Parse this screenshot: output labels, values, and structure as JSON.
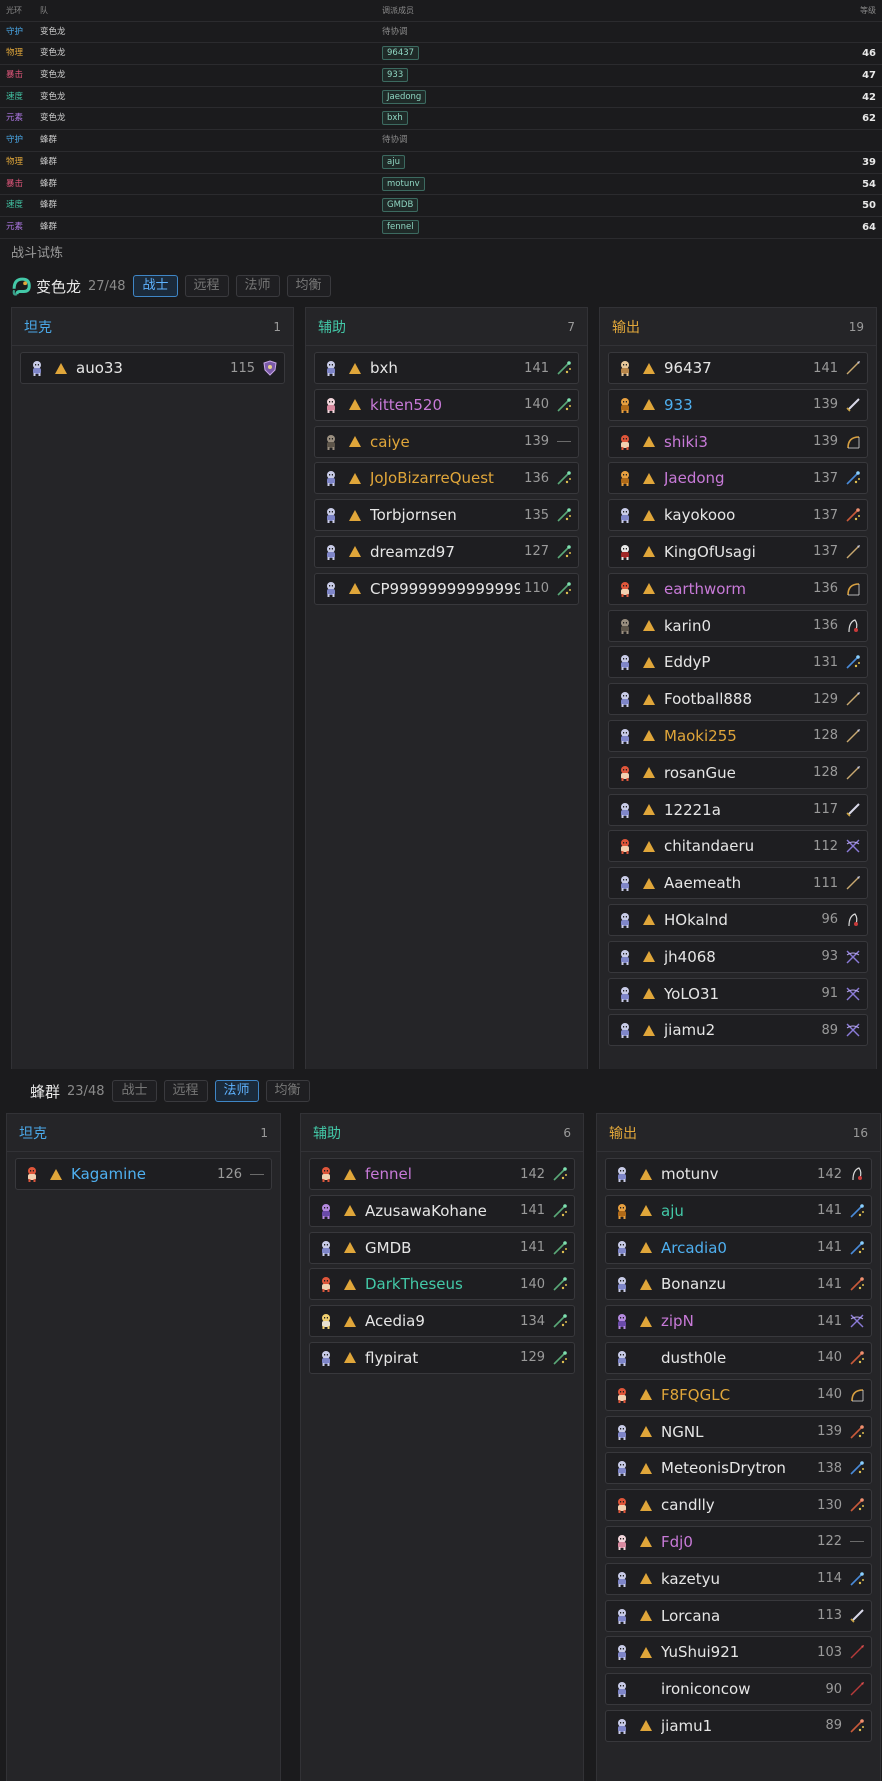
{
  "colors": {
    "tank": "#4aa8e8",
    "support": "#43c9a8",
    "dps": "#e0a63a",
    "blue": "#4fb0f0",
    "pink": "#c87ad8",
    "orange": "#e0a63a",
    "teal": "#43c9a8",
    "white": "#e6e6e6"
  },
  "table": {
    "headers": [
      "光环",
      "队",
      "调派成员",
      "等级"
    ],
    "rows": [
      {
        "aura": "守护",
        "aura_color": "#4aa8e8",
        "team": "变色龙",
        "member": "待协调",
        "pending": true,
        "level": ""
      },
      {
        "aura": "物理",
        "aura_color": "#e0a63a",
        "team": "变色龙",
        "member": "96437",
        "pending": false,
        "level": "46"
      },
      {
        "aura": "暴击",
        "aura_color": "#e0567a",
        "team": "变色龙",
        "member": "933",
        "pending": false,
        "level": "47"
      },
      {
        "aura": "速度",
        "aura_color": "#43c9a8",
        "team": "变色龙",
        "member": "Jaedong",
        "pending": false,
        "level": "42"
      },
      {
        "aura": "元素",
        "aura_color": "#b07ae8",
        "team": "变色龙",
        "member": "bxh",
        "pending": false,
        "level": "62"
      },
      {
        "aura": "守护",
        "aura_color": "#4aa8e8",
        "team": "蜂群",
        "member": "待协调",
        "pending": true,
        "level": ""
      },
      {
        "aura": "物理",
        "aura_color": "#e0a63a",
        "team": "蜂群",
        "member": "aju",
        "pending": false,
        "level": "39"
      },
      {
        "aura": "暴击",
        "aura_color": "#e0567a",
        "team": "蜂群",
        "member": "motunv",
        "pending": false,
        "level": "54"
      },
      {
        "aura": "速度",
        "aura_color": "#43c9a8",
        "team": "蜂群",
        "member": "GMDB",
        "pending": false,
        "level": "50"
      },
      {
        "aura": "元素",
        "aura_color": "#b07ae8",
        "team": "蜂群",
        "member": "fennel",
        "pending": false,
        "level": "64"
      }
    ]
  },
  "section_title": "战斗试炼",
  "filters": [
    "战士",
    "远程",
    "法师",
    "均衡"
  ],
  "teams": [
    {
      "name": "变色龙",
      "count": "27/48",
      "active_filter": 0,
      "icon": "chameleon-icon",
      "columns": [
        {
          "title": "坦克",
          "count": "1",
          "color": "#4aa8e8",
          "players": [
            {
              "name": "auo33",
              "color": "#e6e6e6",
              "level": "115",
              "weapon": "shield",
              "avatar": "ghost",
              "arrow": true
            }
          ]
        },
        {
          "title": "辅助",
          "count": "7",
          "color": "#43c9a8",
          "players": [
            {
              "name": "bxh",
              "color": "#e6e6e6",
              "level": "141",
              "weapon": "staff",
              "avatar": "ghost",
              "arrow": true
            },
            {
              "name": "kitten520",
              "color": "#c87ad8",
              "level": "140",
              "weapon": "staff",
              "avatar": "cat",
              "arrow": true
            },
            {
              "name": "caiye",
              "color": "#e0a63a",
              "level": "139",
              "weapon": "none",
              "avatar": "wolf",
              "arrow": true
            },
            {
              "name": "JoJoBizarreQuest",
              "color": "#e0a63a",
              "level": "136",
              "weapon": "staff",
              "avatar": "ghost",
              "arrow": true
            },
            {
              "name": "Torbjornsen",
              "color": "#e6e6e6",
              "level": "135",
              "weapon": "staff",
              "avatar": "ghost",
              "arrow": true
            },
            {
              "name": "dreamzd97",
              "color": "#e6e6e6",
              "level": "127",
              "weapon": "staff",
              "avatar": "ghost",
              "arrow": true
            },
            {
              "name": "CP99999999999999",
              "color": "#e6e6e6",
              "level": "110",
              "weapon": "staff",
              "avatar": "ghost",
              "arrow": true
            }
          ]
        },
        {
          "title": "输出",
          "count": "19",
          "color": "#e0a63a",
          "players": [
            {
              "name": "96437",
              "color": "#e6e6e6",
              "level": "141",
              "weapon": "spear",
              "avatar": "monk",
              "arrow": true
            },
            {
              "name": "933",
              "color": "#4fb0f0",
              "level": "139",
              "weapon": "sword",
              "avatar": "orange",
              "arrow": true
            },
            {
              "name": "shiki3",
              "color": "#c87ad8",
              "level": "139",
              "weapon": "bow",
              "avatar": "red",
              "arrow": true
            },
            {
              "name": "Jaedong",
              "color": "#c87ad8",
              "level": "137",
              "weapon": "staff-blue",
              "avatar": "orange",
              "arrow": true
            },
            {
              "name": "kayokooo",
              "color": "#e6e6e6",
              "level": "137",
              "weapon": "staff-red",
              "avatar": "ghost",
              "arrow": true
            },
            {
              "name": "KingOfUsagi",
              "color": "#e6e6e6",
              "level": "137",
              "weapon": "spear",
              "avatar": "hat",
              "arrow": true
            },
            {
              "name": "earthworm",
              "color": "#c87ad8",
              "level": "136",
              "weapon": "bow",
              "avatar": "red",
              "arrow": true
            },
            {
              "name": "karin0",
              "color": "#e6e6e6",
              "level": "136",
              "weapon": "whip",
              "avatar": "wolf",
              "arrow": true
            },
            {
              "name": "EddyP",
              "color": "#e6e6e6",
              "level": "131",
              "weapon": "staff-blue",
              "avatar": "ghost",
              "arrow": true
            },
            {
              "name": "Football888",
              "color": "#e6e6e6",
              "level": "129",
              "weapon": "spear",
              "avatar": "ghost",
              "arrow": true
            },
            {
              "name": "Maoki255",
              "color": "#e0a63a",
              "level": "128",
              "weapon": "spear",
              "avatar": "ghost",
              "arrow": true
            },
            {
              "name": "rosanGue",
              "color": "#e6e6e6",
              "level": "128",
              "weapon": "spear",
              "avatar": "red",
              "arrow": true
            },
            {
              "name": "12221a",
              "color": "#e6e6e6",
              "level": "117",
              "weapon": "sword",
              "avatar": "ghost",
              "arrow": true
            },
            {
              "name": "chitandaeru",
              "color": "#e6e6e6",
              "level": "112",
              "weapon": "xbow",
              "avatar": "red",
              "arrow": true
            },
            {
              "name": "Aaemeath",
              "color": "#e6e6e6",
              "level": "111",
              "weapon": "spear",
              "avatar": "ghost",
              "arrow": true
            },
            {
              "name": "HOkalnd",
              "color": "#e6e6e6",
              "level": "96",
              "weapon": "whip",
              "avatar": "ghost",
              "arrow": true
            },
            {
              "name": "jh4068",
              "color": "#e6e6e6",
              "level": "93",
              "weapon": "xbow",
              "avatar": "ghost",
              "arrow": true
            },
            {
              "name": "YoLO31",
              "color": "#e6e6e6",
              "level": "91",
              "weapon": "xbow",
              "avatar": "ghost",
              "arrow": true
            },
            {
              "name": "jiamu2",
              "color": "#e6e6e6",
              "level": "89",
              "weapon": "xbow",
              "avatar": "ghost",
              "arrow": true
            }
          ]
        }
      ]
    },
    {
      "name": "蜂群",
      "count": "23/48",
      "active_filter": 2,
      "icon": "",
      "columns": [
        {
          "title": "坦克",
          "count": "1",
          "color": "#4aa8e8",
          "players": [
            {
              "name": "Kagamine",
              "color": "#4fb0f0",
              "level": "126",
              "weapon": "none",
              "avatar": "red",
              "arrow": true
            }
          ]
        },
        {
          "title": "辅助",
          "count": "6",
          "color": "#43c9a8",
          "players": [
            {
              "name": "fennel",
              "color": "#c87ad8",
              "level": "142",
              "weapon": "staff",
              "avatar": "red",
              "arrow": true
            },
            {
              "name": "AzusawaKohane",
              "color": "#e6e6e6",
              "level": "141",
              "weapon": "staff",
              "avatar": "purple",
              "arrow": true
            },
            {
              "name": "GMDB",
              "color": "#e6e6e6",
              "level": "141",
              "weapon": "staff",
              "avatar": "ghost",
              "arrow": true
            },
            {
              "name": "DarkTheseus",
              "color": "#43c9a8",
              "level": "140",
              "weapon": "staff",
              "avatar": "red",
              "arrow": true
            },
            {
              "name": "Acedia9",
              "color": "#e6e6e6",
              "level": "134",
              "weapon": "staff",
              "avatar": "blonde",
              "arrow": true
            },
            {
              "name": "flypirat",
              "color": "#e6e6e6",
              "level": "129",
              "weapon": "staff",
              "avatar": "ghost",
              "arrow": true
            }
          ]
        },
        {
          "title": "输出",
          "count": "16",
          "color": "#e0a63a",
          "players": [
            {
              "name": "motunv",
              "color": "#e6e6e6",
              "level": "142",
              "weapon": "whip",
              "avatar": "ghost",
              "arrow": true
            },
            {
              "name": "aju",
              "color": "#43c9a8",
              "level": "141",
              "weapon": "staff-blue",
              "avatar": "orange",
              "arrow": true
            },
            {
              "name": "Arcadia0",
              "color": "#4fb0f0",
              "level": "141",
              "weapon": "staff-blue",
              "avatar": "ghost",
              "arrow": true
            },
            {
              "name": "Bonanzu",
              "color": "#e6e6e6",
              "level": "141",
              "weapon": "staff-red",
              "avatar": "ghost",
              "arrow": true
            },
            {
              "name": "zipN",
              "color": "#c87ad8",
              "level": "141",
              "weapon": "xbow",
              "avatar": "purple",
              "arrow": true
            },
            {
              "name": "dusth0le",
              "color": "#e6e6e6",
              "level": "140",
              "weapon": "staff-red",
              "avatar": "ghost",
              "arrow": false
            },
            {
              "name": "F8FQGLC",
              "color": "#e0a63a",
              "level": "140",
              "weapon": "bow",
              "avatar": "red",
              "arrow": true
            },
            {
              "name": "NGNL",
              "color": "#e6e6e6",
              "level": "139",
              "weapon": "staff-red",
              "avatar": "ghost",
              "arrow": true
            },
            {
              "name": "MeteonisDrytron",
              "color": "#e6e6e6",
              "level": "138",
              "weapon": "staff-blue",
              "avatar": "ghost",
              "arrow": true
            },
            {
              "name": "candlly",
              "color": "#e6e6e6",
              "level": "130",
              "weapon": "staff-red",
              "avatar": "red",
              "arrow": true
            },
            {
              "name": "Fdj0",
              "color": "#c87ad8",
              "level": "122",
              "weapon": "none",
              "avatar": "cat",
              "arrow": true
            },
            {
              "name": "kazetyu",
              "color": "#e6e6e6",
              "level": "114",
              "weapon": "staff-blue",
              "avatar": "ghost",
              "arrow": true
            },
            {
              "name": "Lorcana",
              "color": "#e6e6e6",
              "level": "113",
              "weapon": "sword",
              "avatar": "ghost",
              "arrow": true
            },
            {
              "name": "YuShui921",
              "color": "#e6e6e6",
              "level": "103",
              "weapon": "spear-red",
              "avatar": "ghost",
              "arrow": true
            },
            {
              "name": "ironiconcow",
              "color": "#e6e6e6",
              "level": "90",
              "weapon": "spear-red",
              "avatar": "ghost",
              "arrow": false
            },
            {
              "name": "jiamu1",
              "color": "#e6e6e6",
              "level": "89",
              "weapon": "staff-red",
              "avatar": "ghost",
              "arrow": true
            }
          ]
        }
      ]
    }
  ]
}
